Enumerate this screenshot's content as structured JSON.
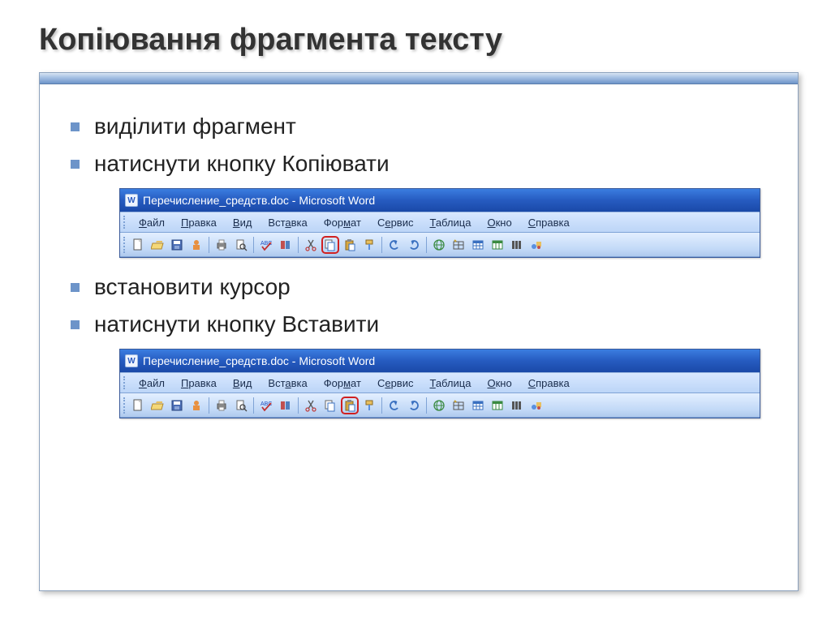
{
  "title": "Копіювання фрагмента тексту",
  "bullets": [
    "виділити фрагмент",
    "натиснути кнопку Копіювати",
    "встановити курсор",
    "натиснути кнопку Вставити"
  ],
  "window": {
    "doc_title": "Перечисление_средств.doc - Microsoft Word",
    "menus": [
      "Файл",
      "Правка",
      "Вид",
      "Вставка",
      "Формат",
      "Сервис",
      "Таблица",
      "Окно",
      "Справка"
    ]
  },
  "icons": {
    "new": "new-doc",
    "open": "open",
    "save": "save",
    "perm": "permission",
    "print": "print",
    "preview": "preview",
    "spell": "spelling",
    "research": "research",
    "cut": "cut",
    "copy": "copy",
    "paste": "paste",
    "format": "format-painter",
    "undo": "undo",
    "redo": "redo",
    "link": "hyperlink",
    "table_border": "tables-borders",
    "insert_table": "insert-table",
    "excel": "excel",
    "columns": "columns",
    "drawing": "drawing"
  },
  "highlight_top": "copy",
  "highlight_bottom": "paste"
}
